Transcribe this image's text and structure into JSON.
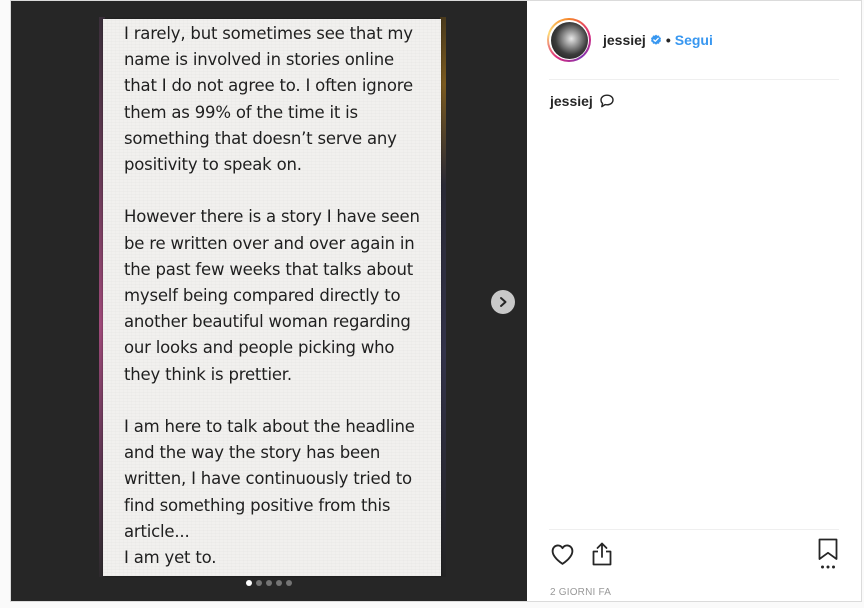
{
  "post": {
    "slide_text": [
      "I rarely, but sometimes see that my\nname is involved in stories online\nthat I do not agree to. I often ignore\nthem as 99% of the time it is\nsomething that doesn’t serve any\npositivity to speak on.",
      "However there is a story I have seen\nbe re written over and over again in\nthe past few weeks that talks about\nmyself being compared directly to\nanother beautiful woman regarding\nour looks and people picking who\nthey think is prettier.",
      "I am here to talk about the headline\nand the way the story has been\nwritten, I have continuously tried to\nfind something positive from this\narticle...\nI am yet to."
    ],
    "carousel": {
      "slide_count": 5,
      "active_index": 0
    }
  },
  "header": {
    "username": "jessiej",
    "separator": "•",
    "follow_label": "Segui",
    "verified_icon": "verified-badge-icon"
  },
  "caption": {
    "username": "jessiej"
  },
  "footer": {
    "timestamp": "2 GIORNI FA"
  },
  "colors": {
    "accent": "#3897f0",
    "media_background": "#262626",
    "text_primary": "#262626",
    "text_muted": "#999999"
  },
  "icons": {
    "next": "chevron-right-icon",
    "like": "heart-icon",
    "share": "share-icon",
    "save": "bookmark-icon",
    "comment": "speech-bubble-icon"
  }
}
